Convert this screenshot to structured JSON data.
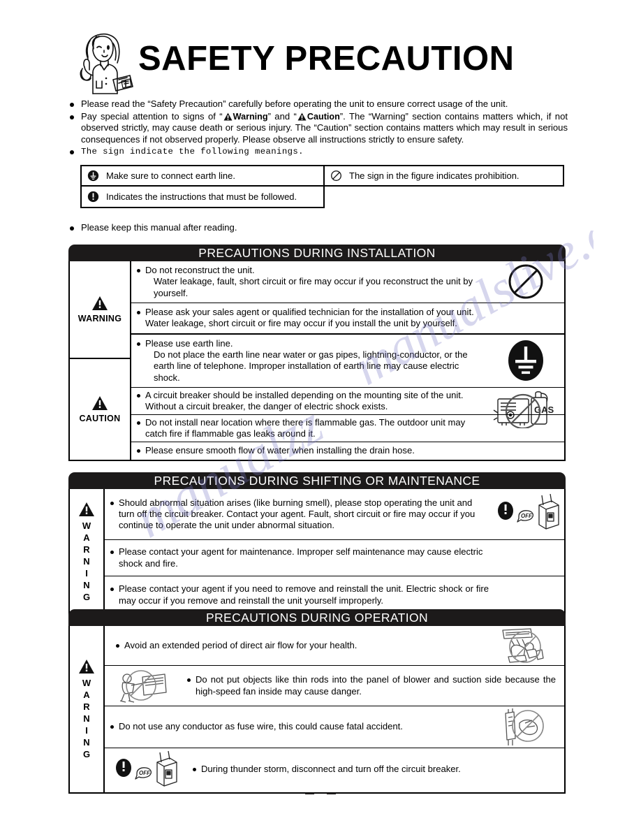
{
  "document": {
    "title": "SAFETY PRECAUTION",
    "page_number": "",
    "mascot_alt": "woman-pointing-illustration"
  },
  "intro": {
    "bullets": [
      "Please read the “Safety Precaution” carefully before operating the unit to ensure correct usage of the unit.",
      "Pay special attention to signs of “",
      "The sign indicate the following meanings."
    ],
    "warning_word": "Warning",
    "caution_word": "Caution",
    "bullet2_mid": "” and “",
    "bullet2_tail": "”. The “Warning” section contains matters which, if not observed strictly, may cause death or serious injury. The “Caution” section contains matters which may result in serious consequences if not observed properly. Please observe all instructions strictly to ensure safety.",
    "keep_manual": "Please keep this manual after reading."
  },
  "legend": {
    "rows": [
      {
        "icon": "earth-line-icon",
        "text": "Make sure to connect earth line."
      },
      {
        "icon": "exclamation-icon",
        "text": "Indicates the instructions that must be followed."
      }
    ],
    "right": {
      "icon": "prohibition-icon",
      "text": "The sign in the figure indicates prohibition."
    }
  },
  "sections": [
    {
      "id": "installation",
      "header": "PRECAUTIONS DURING INSTALLATION",
      "blocks": [
        {
          "level": "WARNING",
          "level_style": "horizontal",
          "icon": "warning-triangle-icon",
          "rows": [
            {
              "text": "Do not reconstruct the unit.",
              "cont": "Water leakage, fault, short circuit or fire may occur if you reconstruct the unit by yourself.",
              "icon": "prohibition-icon"
            },
            {
              "text": "Please ask your sales agent or qualified technician for the installation of your unit. Water leakage, short circuit or fire may occur if you install the unit by yourself.",
              "cont": "",
              "icon": ""
            }
          ]
        },
        {
          "level": "CAUTION",
          "level_style": "horizontal",
          "icon": "warning-triangle-icon",
          "rows": [
            {
              "text": "Please use earth line.",
              "cont": "Do not place the earth line near water or gas pipes, lightning-conductor, or the earth line of telephone. Improper installation of earth line may cause electric shock.",
              "icon": "earth-ground-icon"
            },
            {
              "text": "A circuit breaker should be installed depending on the mounting site of the unit. Without a circuit breaker, the danger of electric shock exists.",
              "cont": "",
              "icon": "no-gas-outdoor-unit-icon"
            },
            {
              "text": "Do not install near location where there is flammable gas. The outdoor unit may catch fire if flammable gas leaks around it.",
              "cont": "",
              "icon": ""
            },
            {
              "text": "Please ensure smooth flow of water when installing the drain hose.",
              "cont": "",
              "icon": ""
            }
          ]
        }
      ]
    },
    {
      "id": "shifting-maintenance",
      "header": "PRECAUTIONS DURING SHIFTING OR MAINTENANCE",
      "blocks": [
        {
          "level": "WARNING",
          "level_style": "vertical",
          "icon": "warning-triangle-icon",
          "rows": [
            {
              "text": "Should abnormal situation arises (like burning smell), please stop operating the unit and turn off the circuit breaker. Contact your agent. Fault, short circuit or fire may occur if you continue to operate the unit under abnormal situation.",
              "cont": "",
              "icon": "breaker-off-icon"
            },
            {
              "text": "Please contact your agent for maintenance. Improper self maintenance may cause electric shock and fire.",
              "cont": "",
              "icon": ""
            },
            {
              "text": "Please contact your agent if you need to remove and reinstall the unit. Electric shock or fire may occur if you remove and reinstall the unit yourself improperly.",
              "cont": "",
              "icon": ""
            }
          ]
        }
      ]
    },
    {
      "id": "operation",
      "header": "PRECAUTIONS DURING OPERATION",
      "blocks": [
        {
          "level": "WARNING",
          "level_style": "vertical",
          "icon": "warning-triangle-icon",
          "rows": [
            {
              "text": "Avoid an extended period of direct air flow for your health.",
              "cont": "",
              "icon": "no-direct-airflow-icon",
              "icon_side": "right"
            },
            {
              "text": "Do not put objects like thin rods into the panel of blower and suction side because the high-speed fan inside may cause danger.",
              "cont": "",
              "icon": "no-rod-in-fan-icon",
              "icon_side": "left"
            },
            {
              "text": "Do not use any conductor as fuse wire, this could cause fatal accident.",
              "cont": "",
              "icon": "no-conductor-fuse-icon",
              "icon_side": "right"
            },
            {
              "text": "During thunder storm, disconnect and turn off the circuit breaker.",
              "cont": "",
              "icon": "breaker-off-icon",
              "icon_side": "left"
            }
          ]
        }
      ]
    }
  ],
  "watermark": {
    "line1": "manualzz",
    "line2": "manualslive.com"
  },
  "colors": {
    "header_bar": "#1c1a1a",
    "text": "#000000",
    "watermark": "#7b79c4"
  }
}
